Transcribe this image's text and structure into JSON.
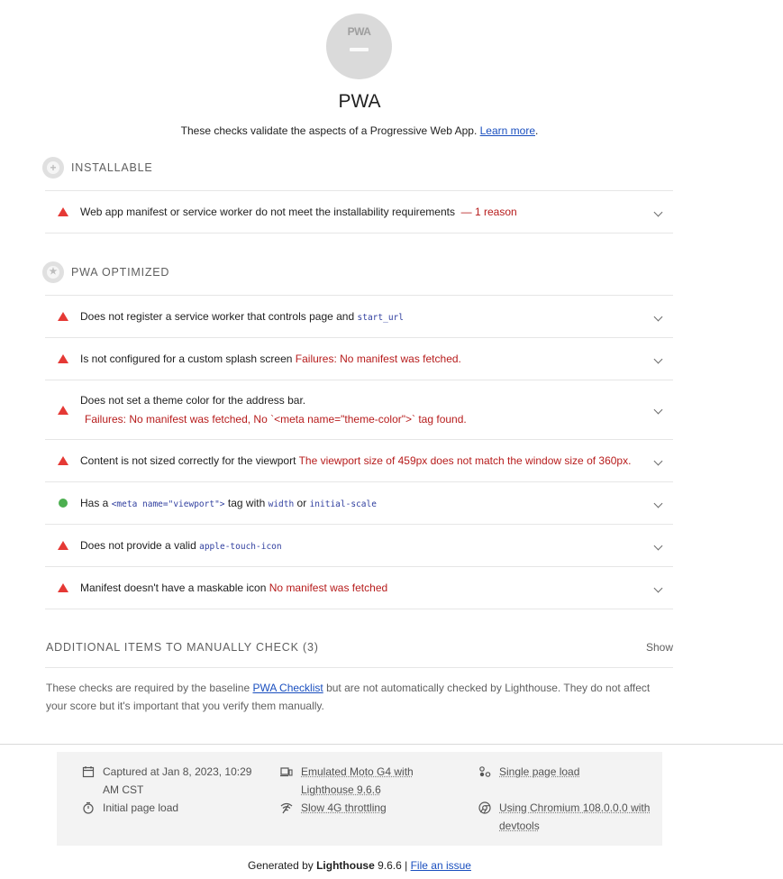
{
  "gauge": {
    "label": "PWA"
  },
  "category": {
    "title": "PWA",
    "description": "These checks validate the aspects of a Progressive Web App.",
    "learn_more": "Learn more",
    "period": "."
  },
  "groups": {
    "installable": {
      "title": "INSTALLABLE",
      "audits": [
        {
          "status": "fail",
          "text": "Web app manifest or service worker do not meet the installability requirements",
          "detail": "— 1 reason"
        }
      ]
    },
    "optimized": {
      "title": "PWA OPTIMIZED",
      "audits": [
        {
          "status": "fail",
          "text": "Does not register a service worker that controls page and",
          "code": "start_url"
        },
        {
          "status": "fail",
          "text": "Is not configured for a custom splash screen",
          "detail": "Failures: No manifest was fetched."
        },
        {
          "status": "fail",
          "text": "Does not set a theme color for the address bar.",
          "detail": "Failures: No manifest was fetched, No `<meta name=\"theme-color\">` tag found."
        },
        {
          "status": "fail",
          "text": "Content is not sized correctly for the viewport",
          "detail": "The viewport size of 459px does not match the window size of 360px."
        },
        {
          "status": "pass",
          "text_a": "Has a",
          "code_a": "<meta name=\"viewport\">",
          "text_b": "tag with",
          "code_b": "width",
          "text_c": "or",
          "code_c": "initial-scale"
        },
        {
          "status": "fail",
          "text": "Does not provide a valid",
          "code": "apple-touch-icon"
        },
        {
          "status": "fail",
          "text": "Manifest doesn't have a maskable icon",
          "detail": "No manifest was fetched"
        }
      ]
    }
  },
  "manual": {
    "title": "ADDITIONAL ITEMS TO MANUALLY CHECK (3)",
    "show": "Show",
    "desc_a": "These checks are required by the baseline",
    "checklist_link": "PWA Checklist",
    "desc_b": "but are not automatically checked by Lighthouse. They do not affect your score but it's important that you verify them manually."
  },
  "environment": {
    "captured": "Captured at Jan 8, 2023, 10:29 AM CST",
    "initial_load": "Initial page load",
    "emulated": "Emulated Moto G4 with Lighthouse 9.6.6",
    "throttling": "Slow 4G throttling",
    "single_load": "Single page load",
    "chromium": "Using Chromium 108.0.0.0 with devtools"
  },
  "footer": {
    "generated_by": "Generated by",
    "product": "Lighthouse",
    "version": "9.6.6 |",
    "file_issue": "File an issue"
  },
  "colors": {
    "fail": "#e53935",
    "pass": "#4caf50",
    "link": "#1a4fbf"
  }
}
